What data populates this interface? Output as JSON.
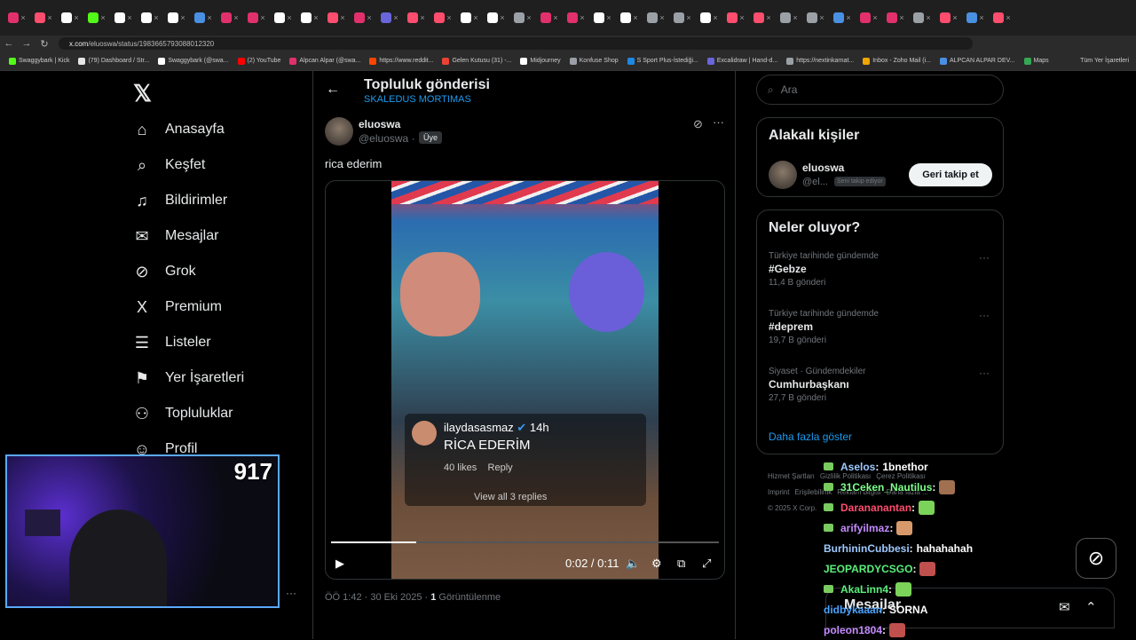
{
  "browser": {
    "url_host": "x.com",
    "url_path": "/eluoswa/status/1983665793088012320",
    "bookmarks": [
      {
        "label": "Swaggybark | Kick",
        "color": "#53fc18"
      },
      {
        "label": "(79) Dashboard / Str...",
        "color": "#e5e5e5"
      },
      {
        "label": "Swaggybark (@swa...",
        "color": "#ffffff"
      },
      {
        "label": "(2) YouTube",
        "color": "#ff0000"
      },
      {
        "label": "Alpcan Alpar (@swa...",
        "color": "#e1306c"
      },
      {
        "label": "https://www.reddit...",
        "color": "#ff4500"
      },
      {
        "label": "Gelen Kutusu (31) -...",
        "color": "#ea4335"
      },
      {
        "label": "Midjourney",
        "color": "#ffffff"
      },
      {
        "label": "Konfuse Shop",
        "color": "#9aa0a6"
      },
      {
        "label": "S Sport Plus-İstediği...",
        "color": "#1e88e5"
      },
      {
        "label": "Excalidraw | Hand-d...",
        "color": "#6965db"
      },
      {
        "label": "https://nextinkarnat...",
        "color": "#9aa0a6"
      },
      {
        "label": "Inbox - Zoho Mail (i...",
        "color": "#f0a500"
      },
      {
        "label": "ALPCAN ALPAR DEV...",
        "color": "#4a90e2"
      },
      {
        "label": "Maps",
        "color": "#34a853"
      }
    ],
    "all_bookmarks": "Tüm Yer İşaretleri"
  },
  "sidebar": {
    "items": [
      {
        "label": "Anasayfa",
        "icon": "⌂"
      },
      {
        "label": "Keşfet",
        "icon": "⌕"
      },
      {
        "label": "Bildirimler",
        "icon": "♫"
      },
      {
        "label": "Mesajlar",
        "icon": "✉"
      },
      {
        "label": "Grok",
        "icon": "⊘"
      },
      {
        "label": "Premium",
        "icon": "X"
      },
      {
        "label": "Listeler",
        "icon": "☰"
      },
      {
        "label": "Yer İşaretleri",
        "icon": "⚑"
      },
      {
        "label": "Topluluklar",
        "icon": "⚇"
      },
      {
        "label": "Profil",
        "icon": "☺"
      }
    ]
  },
  "header": {
    "title": "Topluluk gönderisi",
    "subtitle": "SKALEDUS MORTIMAS"
  },
  "post": {
    "name": "eluoswa",
    "handle": "@eluoswa",
    "sep": "·",
    "badge": "Üye",
    "text": "rica ederim",
    "video": {
      "overlay_user": "ilaydasasmaz",
      "overlay_time": "14h",
      "overlay_text": "RİCA EDERİM",
      "overlay_likes": "40 likes",
      "overlay_reply": "Reply",
      "overlay_all": "View all 3 replies",
      "time": "0:02 / 0:11",
      "progress": 0.22
    },
    "meta_time": "ÖÖ 1:42 · 30 Eki 2025 ·",
    "views_count": "1",
    "views_label": "Görüntülenme"
  },
  "search": {
    "placeholder": "Ara"
  },
  "related": {
    "title": "Alakalı kişiler",
    "name": "eluoswa",
    "handle": "@el...",
    "badge": "Seni takip ediyor",
    "button": "Geri takip et"
  },
  "trends": {
    "title": "Neler oluyor?",
    "items": [
      {
        "context": "Türkiye tarihinde gündemde",
        "topic": "#Gebze",
        "count": "11,4 B gönderi"
      },
      {
        "context": "Türkiye tarihinde gündemde",
        "topic": "#deprem",
        "count": "19,7 B gönderi"
      },
      {
        "context": "Siyaset · Gündemdekiler",
        "topic": "Cumhurbaşkanı",
        "count": "27,7 B gönderi"
      }
    ],
    "show_more": "Daha fazla göster"
  },
  "footer": {
    "items": [
      "Hizmet Şartları",
      "Gizlilik Politikası",
      "Çerez Politikası",
      "Imprint",
      "Erişilebilirlik",
      "Reklam bilgisi",
      "Daha fazla ...",
      "© 2025 X Corp."
    ]
  },
  "webcam": {
    "count": "917"
  },
  "chat": [
    {
      "user": "Aselos",
      "color": "#9ec9ff",
      "msg": "1bnethor",
      "badge": true,
      "emote": ""
    },
    {
      "user": "31Ceken_Nautilus",
      "color": "#7dff8a",
      "msg": "",
      "badge": true,
      "emote": "#a07050"
    },
    {
      "user": "Darananantan",
      "color": "#ff4d6d",
      "msg": "",
      "badge": true,
      "emote": "#7bd35a"
    },
    {
      "user": "arifyilmaz",
      "color": "#c58bff",
      "msg": "",
      "badge": true,
      "emote": "#d89a6a"
    },
    {
      "user": "BurhininCubbesi",
      "color": "#9ec9ff",
      "msg": "hahahahah",
      "badge": false,
      "emote": ""
    },
    {
      "user": "JEOPARDYCSGO",
      "color": "#59f07a",
      "msg": "",
      "badge": false,
      "emote": "#c0504d"
    },
    {
      "user": "AkaLinn4",
      "color": "#59f07a",
      "msg": "",
      "badge": true,
      "emote": "#7bd35a"
    },
    {
      "user": "didbykaaan",
      "color": "#4aa3ff",
      "msg": "SORNA",
      "badge": false,
      "emote": ""
    },
    {
      "user": "poleon1804",
      "color": "#c58bff",
      "msg": "",
      "badge": false,
      "emote": "#c0504d"
    }
  ],
  "messages_drawer": {
    "title": "Mesajlar"
  }
}
